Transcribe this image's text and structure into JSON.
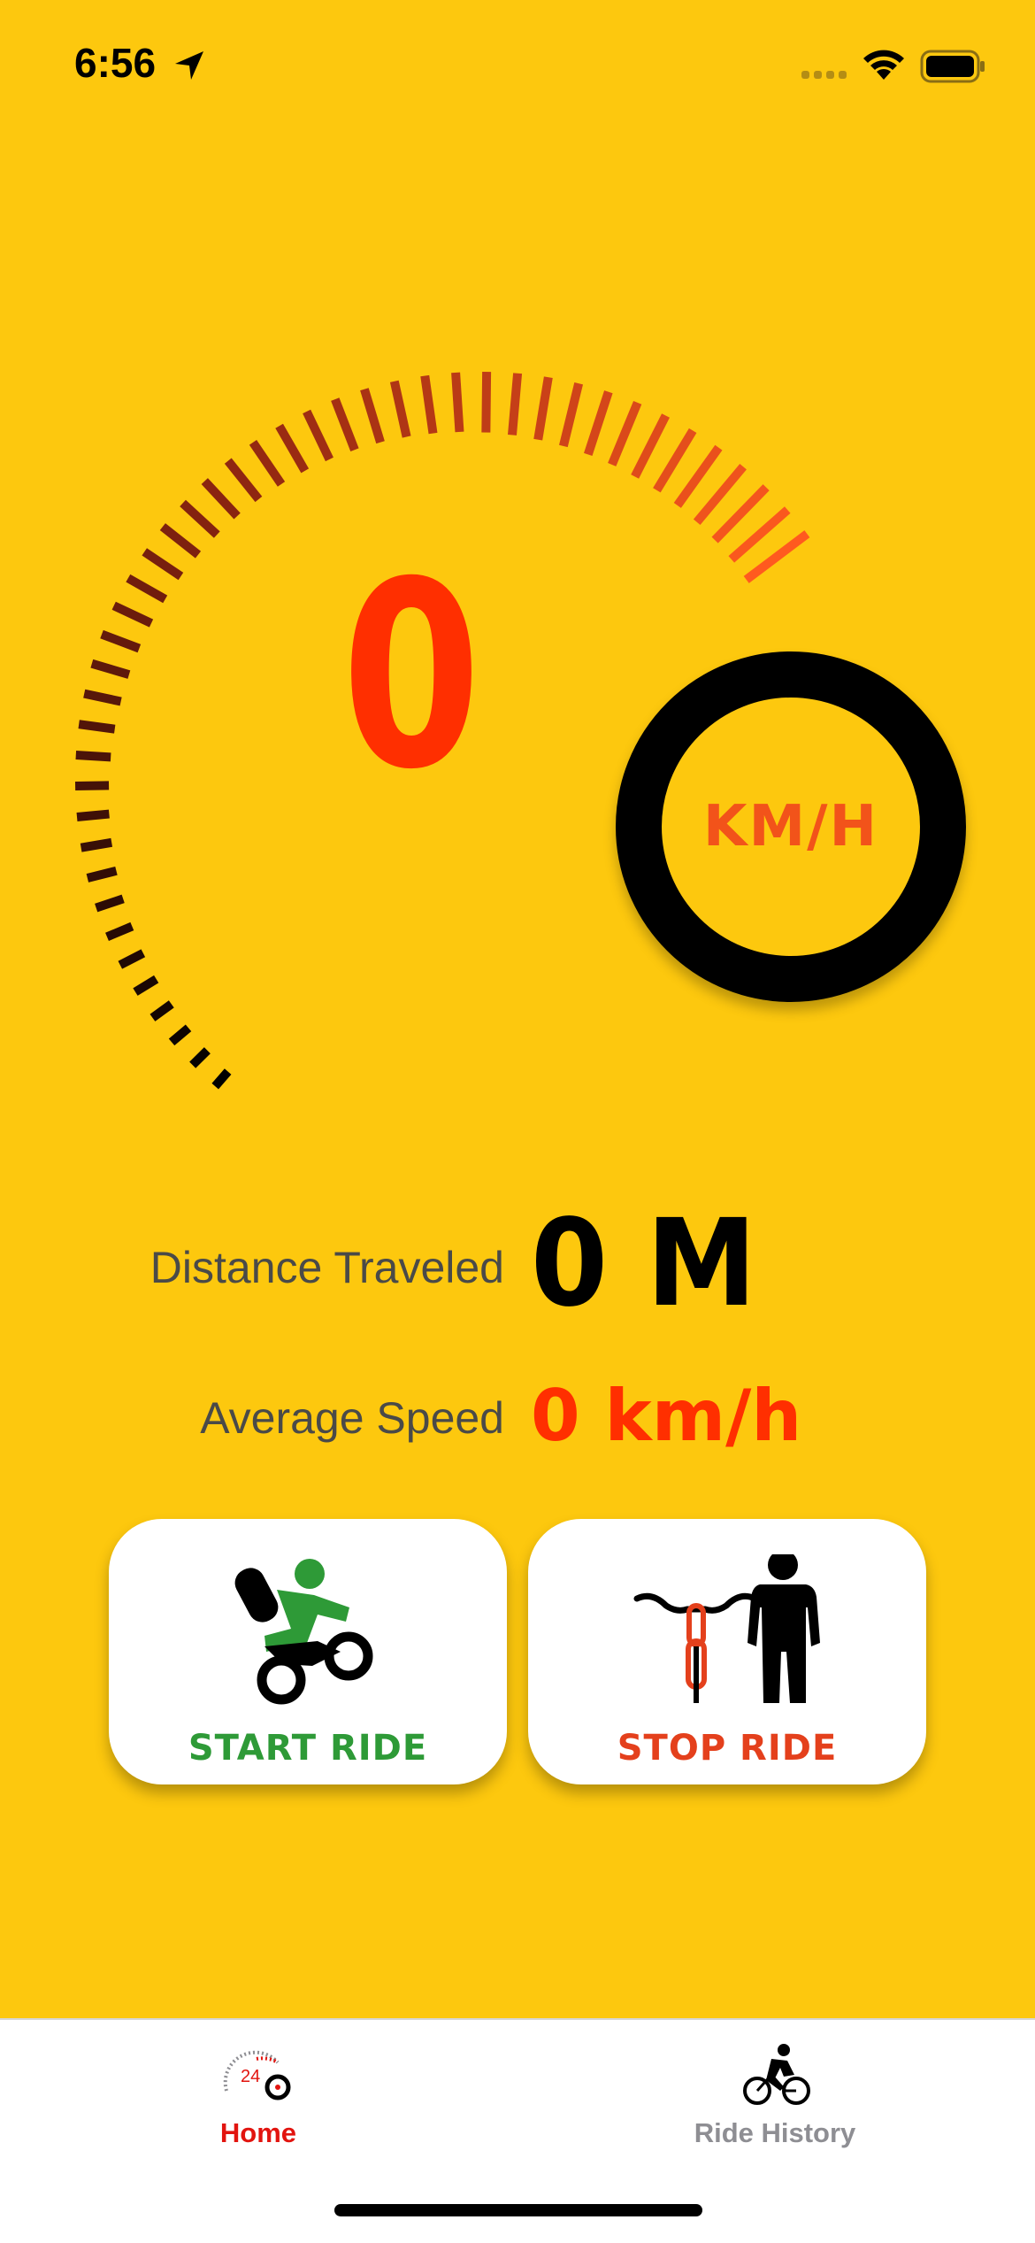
{
  "status_bar": {
    "time": "6:56",
    "icons": [
      "location-arrow-icon",
      "cellular-signal-icon",
      "wifi-icon",
      "battery-icon"
    ]
  },
  "speedometer": {
    "speed": "0",
    "unit": "KM/H",
    "colors": {
      "speed": "#FF2F00",
      "unit": "#F2531A",
      "ticks_start": "#000000",
      "ticks_mid": "#8A2410",
      "ticks_end": "#FF5A1F"
    }
  },
  "stats": {
    "distance_label": "Distance Traveled",
    "distance_value": "0 M",
    "average_label": "Average Speed",
    "average_value": "0 km/h"
  },
  "actions": {
    "start_label": "START RIDE",
    "start_icon": "motorcycle-rider-icon",
    "stop_label": "STOP RIDE",
    "stop_icon": "standing-person-with-bicycle-icon"
  },
  "tab_bar": {
    "tabs": [
      {
        "label": "Home",
        "icon": "speedometer-24-icon",
        "active": true
      },
      {
        "label": "Ride History",
        "icon": "cyclist-icon",
        "active": false
      }
    ]
  },
  "theme": {
    "background": "#FDC80E",
    "active_tab": "#E2140F",
    "inactive_tab": "#8E8E93",
    "start_green": "#2E9A37",
    "stop_red": "#E4401C"
  }
}
